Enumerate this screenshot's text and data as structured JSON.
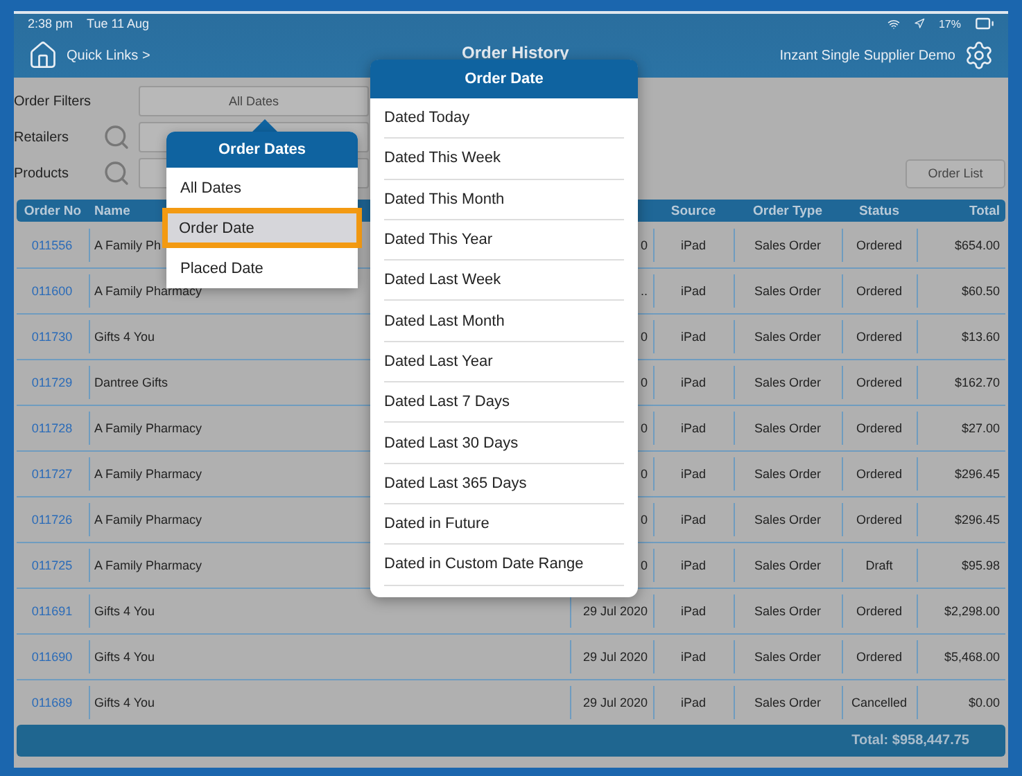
{
  "status_bar": {
    "time": "2:38 pm",
    "date": "Tue 11 Aug",
    "battery": "17%"
  },
  "header": {
    "quick_links": "Quick Links >",
    "title": "Order History",
    "account": "Inzant Single Supplier Demo"
  },
  "filters": {
    "order_filters_label": "Order Filters",
    "date_button": "All Dates",
    "retailers_label": "Retailers",
    "products_label": "Products",
    "order_list_button": "Order List"
  },
  "table": {
    "columns": [
      {
        "label": "Order No"
      },
      {
        "label": "Name"
      },
      {},
      {
        "label": "Source"
      },
      {
        "label": "Order Type"
      },
      {
        "label": "Status"
      },
      {
        "label": "Total"
      }
    ],
    "rows": [
      [
        "011556",
        "A Family Ph",
        "0",
        "iPad",
        "Sales Order",
        "Ordered",
        "$654.00"
      ],
      [
        "011600",
        "A Family Pharmacy",
        "..",
        "iPad",
        "Sales Order",
        "Ordered",
        "$60.50"
      ],
      [
        "011730",
        "Gifts 4 You",
        "0",
        "iPad",
        "Sales Order",
        "Ordered",
        "$13.60"
      ],
      [
        "011729",
        "Dantree Gifts",
        "0",
        "iPad",
        "Sales Order",
        "Ordered",
        "$162.70"
      ],
      [
        "011728",
        "A Family Pharmacy",
        "0",
        "iPad",
        "Sales Order",
        "Ordered",
        "$27.00"
      ],
      [
        "011727",
        "A Family Pharmacy",
        "0",
        "iPad",
        "Sales Order",
        "Ordered",
        "$296.45"
      ],
      [
        "011726",
        "A Family Pharmacy",
        "0",
        "iPad",
        "Sales Order",
        "Ordered",
        "$296.45"
      ],
      [
        "011725",
        "A Family Pharmacy",
        "0",
        "iPad",
        "Sales Order",
        "Draft",
        "$95.98"
      ],
      [
        "011691",
        "Gifts 4 You",
        "29 Jul 2020",
        "iPad",
        "Sales Order",
        "Ordered",
        "$2,298.00"
      ],
      [
        "011690",
        "Gifts 4 You",
        "29 Jul 2020",
        "iPad",
        "Sales Order",
        "Ordered",
        "$5,468.00"
      ],
      [
        "011689",
        "Gifts 4 You",
        "29 Jul 2020",
        "iPad",
        "Sales Order",
        "Cancelled",
        "$0.00"
      ]
    ],
    "total": "Total: $958,447.75"
  },
  "order_dates": {
    "title": "Order Dates",
    "items": [
      {
        "label": "All Dates",
        "selected": false
      },
      {
        "label": "Order Date",
        "selected": true
      },
      {
        "label": "Placed Date",
        "selected": false
      }
    ]
  },
  "order_date": {
    "title": "Order Date",
    "items": [
      "Dated Today",
      "Dated This Week",
      "Dated This Month",
      "Dated This Year",
      "Dated Last Week",
      "Dated Last Month",
      "Dated Last Year",
      "Dated Last 7 Days",
      "Dated Last 30 Days",
      "Dated Last 365 Days",
      "Dated in Future",
      "Dated in Custom Date Range"
    ]
  }
}
